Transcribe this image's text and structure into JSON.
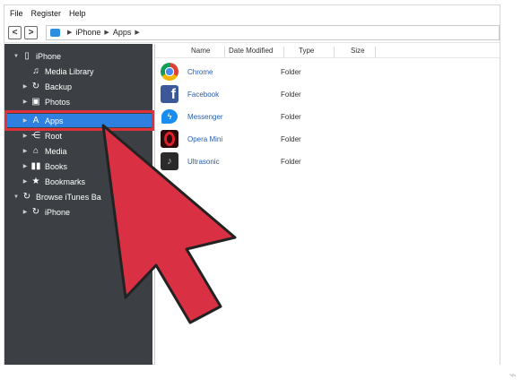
{
  "menu": {
    "items": [
      "File",
      "Register",
      "Help"
    ]
  },
  "addressbar": {
    "back": "<",
    "forward": ">",
    "crumbs": [
      "iPhone",
      "Apps"
    ]
  },
  "sidebar": {
    "items": [
      {
        "label": "iPhone",
        "icon": "phone-icon",
        "arrow": "▾"
      },
      {
        "label": "Media Library",
        "icon": "music-note-icon",
        "arrow": ""
      },
      {
        "label": "Backup",
        "icon": "backup-icon",
        "arrow": "▸"
      },
      {
        "label": "Photos",
        "icon": "photo-icon",
        "arrow": "▸"
      },
      {
        "label": "Apps",
        "icon": "apps-icon",
        "arrow": "▸"
      },
      {
        "label": "Root",
        "icon": "root-icon",
        "arrow": "▸"
      },
      {
        "label": "Media",
        "icon": "media-icon",
        "arrow": "▸"
      },
      {
        "label": "Books",
        "icon": "books-icon",
        "arrow": "▸"
      },
      {
        "label": "Bookmarks",
        "icon": "star-icon",
        "arrow": "▸"
      },
      {
        "label": "Browse iTunes Ba",
        "icon": "itunes-icon",
        "arrow": "▾"
      },
      {
        "label": "iPhone",
        "icon": "backup-icon",
        "arrow": "▸"
      }
    ]
  },
  "table": {
    "headers": [
      "Name",
      "Date Modified",
      "Type",
      "Size"
    ],
    "rows": [
      {
        "name": "Chrome",
        "type": "Folder",
        "icon": "chrome-icon"
      },
      {
        "name": "Facebook",
        "type": "Folder",
        "icon": "facebook-icon"
      },
      {
        "name": "Messenger",
        "type": "Folder",
        "icon": "messenger-icon"
      },
      {
        "name": "Opera Mini",
        "type": "Folder",
        "icon": "opera-icon"
      },
      {
        "name": "Ultrasonic",
        "type": "Folder",
        "icon": "ultrasonic-icon"
      }
    ]
  },
  "colors": {
    "sidebar_bg": "#3c4044",
    "selection": "#2d7fe0",
    "highlight": "#e0303a",
    "cursor": "#d93043"
  }
}
